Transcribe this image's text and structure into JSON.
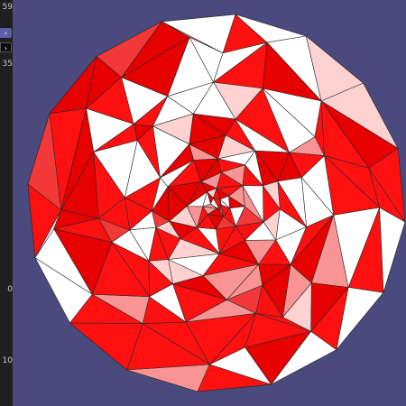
{
  "sidebar": {
    "top_value": "59",
    "button_1_icon": "chevron-right-icon",
    "button_1_glyph": "›",
    "button_2_icon": "chevron-right-icon",
    "button_2_glyph": "›",
    "value_a": "35",
    "value_b": "0",
    "value_c": "10"
  },
  "scene": {
    "background_color": "#4b4a7e",
    "palette": {
      "red": "#ff1010",
      "red_dark": "#e60000",
      "red_soft": "#f23838",
      "pink": "#f99494",
      "pink_light": "#ffd2d2",
      "white": "#ffffff",
      "edge": "#2a2a2a"
    }
  }
}
